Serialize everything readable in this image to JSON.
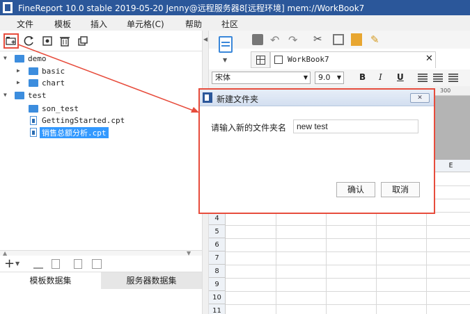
{
  "window": {
    "title": "FineReport 10.0 stable 2019-05-20 Jenny@远程服务器8[远程环境]    mem://WorkBook7"
  },
  "menu": [
    "文件",
    "模板",
    "插入",
    "单元格(C)",
    "帮助",
    "社区"
  ],
  "left_toolbar": {
    "icons": [
      "new-folder-icon",
      "refresh-icon",
      "settings-icon",
      "delete-icon",
      "copy-icon"
    ]
  },
  "tree": {
    "items": [
      {
        "label": "demo",
        "type": "folder",
        "expanded": true
      },
      {
        "label": "basic",
        "type": "folder"
      },
      {
        "label": "chart",
        "type": "folder"
      },
      {
        "label": "test",
        "type": "folder",
        "expanded": true
      },
      {
        "label": "son_test",
        "type": "folder"
      },
      {
        "label": "GettingStarted.cpt",
        "type": "file"
      },
      {
        "label": "销售总额分析.cpt",
        "type": "file",
        "selected": true
      }
    ]
  },
  "bottom_tabs": [
    "模板数据集",
    "服务器数据集"
  ],
  "tab": {
    "label": "WorkBook7"
  },
  "font": {
    "name": "宋体",
    "size": "9.0"
  },
  "format_buttons": [
    "B",
    "I",
    "U"
  ],
  "ruler": {
    "mark": "300"
  },
  "grid": {
    "column_header_visible": "E",
    "rows": [
      "4",
      "5",
      "6",
      "7",
      "8",
      "9",
      "10",
      "11"
    ]
  },
  "dialog": {
    "title": "新建文件夹",
    "prompt": "请输入新的文件夹名",
    "input_value": "new test",
    "confirm_label": "确认",
    "cancel_label": "取消"
  },
  "colors": {
    "titlebar": "#2b579a",
    "highlight": "#e74c3c",
    "selection": "#3399ff"
  }
}
